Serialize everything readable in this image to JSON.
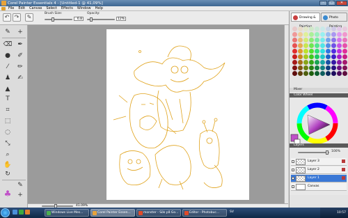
{
  "window": {
    "title": "Corel Painter Essentials 4 - [Untitled-1 @ 41,09%]"
  },
  "menu": [
    "File",
    "Edit",
    "Canvas",
    "Select",
    "Effects",
    "Window",
    "Help"
  ],
  "propbar": {
    "brush_size_label": "Brush Size:",
    "brush_size_value": "6.8",
    "opacity_label": "Opacity:",
    "opacity_value": "12%"
  },
  "status": {
    "zoom": "41.09%"
  },
  "right_tabs": {
    "drawing": "Drawing & Painting",
    "photo": "Photo Painting"
  },
  "panels": {
    "mixer": "Mixer",
    "color_wheel": "Color Wheel",
    "layers": "Layers",
    "opacity": "100%"
  },
  "layers": [
    {
      "name": "Layer 3"
    },
    {
      "name": "Layer 2"
    },
    {
      "name": "Layer 1"
    },
    {
      "name": "Canvas"
    }
  ],
  "taskbar": {
    "tasks": [
      "Windows Live Mes...",
      "Corel Painter Essen...",
      "monster - Sök på Go...",
      "Editor - Photobuc..."
    ],
    "lang": "SV",
    "clock": "10:57"
  },
  "colors": {
    "accent": "#3a78d6",
    "line_art": "#e0a21a",
    "selected_color": "#c050c8"
  }
}
